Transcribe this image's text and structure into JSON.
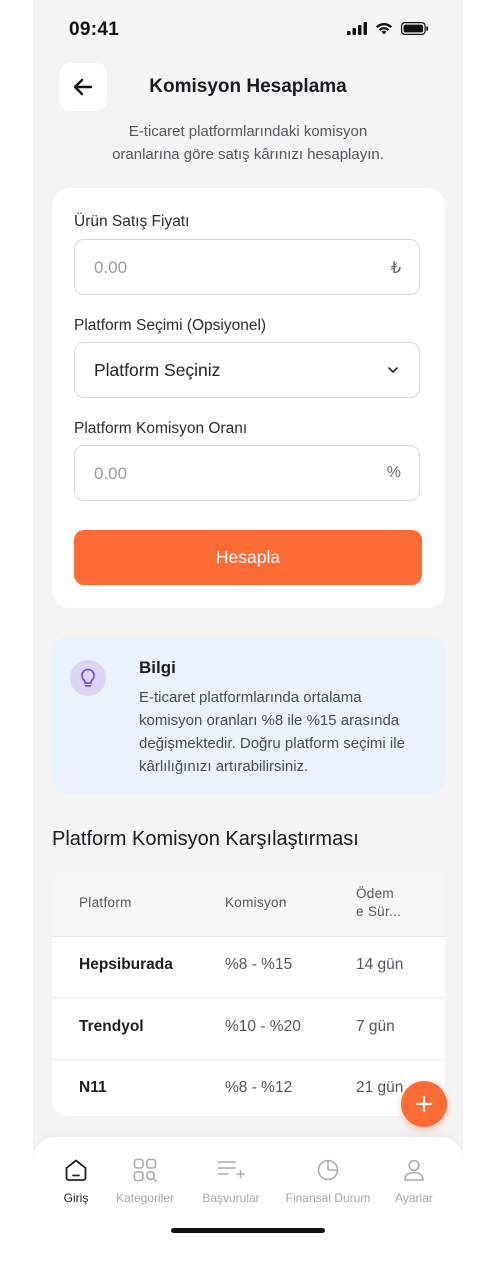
{
  "status_bar": {
    "time": "09:41"
  },
  "header": {
    "title": "Komisyon Hesaplama",
    "subtitle": "E-ticaret platformlarındaki komisyon oranlarına göre satış kârınızı hesaplayın."
  },
  "form": {
    "price_label": "Ürün Satış Fiyatı",
    "price_placeholder": "0.00",
    "price_suffix": "₺",
    "platform_label": "Platform Seçimi (Opsiyonel)",
    "platform_value": "Platform Seçiniz",
    "rate_label": "Platform Komisyon Oranı",
    "rate_placeholder": "0.00",
    "rate_suffix": "%",
    "submit_label": "Hesapla"
  },
  "info": {
    "title": "Bilgi",
    "text": "E-ticaret platformlarında ortalama komisyon oranları %8 ile %15 arasında değişmektedir. Doğru platform seçimi ile kârlılığınızı artırabilirsiniz."
  },
  "comparison": {
    "title": "Platform Komisyon Karşılaştırması",
    "headers": {
      "platform": "Platform",
      "commission": "Komisyon",
      "payment_line1": "Ödem",
      "payment_line2": "e Sür..."
    },
    "rows": [
      {
        "platform": "Hepsiburada",
        "commission": "%8 - %15",
        "payment": "14 gün"
      },
      {
        "platform": "Trendyol",
        "commission": "%10 - %20",
        "payment": "7 gün"
      },
      {
        "platform": "N11",
        "commission": "%8 - %12",
        "payment": "21 gün"
      }
    ]
  },
  "nav": {
    "items": [
      {
        "label": "Giriş",
        "icon": "home-icon"
      },
      {
        "label": "Kategoriler",
        "icon": "categories-icon"
      },
      {
        "label": "Başvurular",
        "icon": "applications-icon"
      },
      {
        "label": "Finansal Durum",
        "icon": "pie-chart-icon"
      },
      {
        "label": "Ayarlar",
        "icon": "user-icon"
      }
    ]
  },
  "colors": {
    "accent": "#ff6b35",
    "info_bg": "#eaf2fd",
    "info_icon": "#7c3aed"
  }
}
